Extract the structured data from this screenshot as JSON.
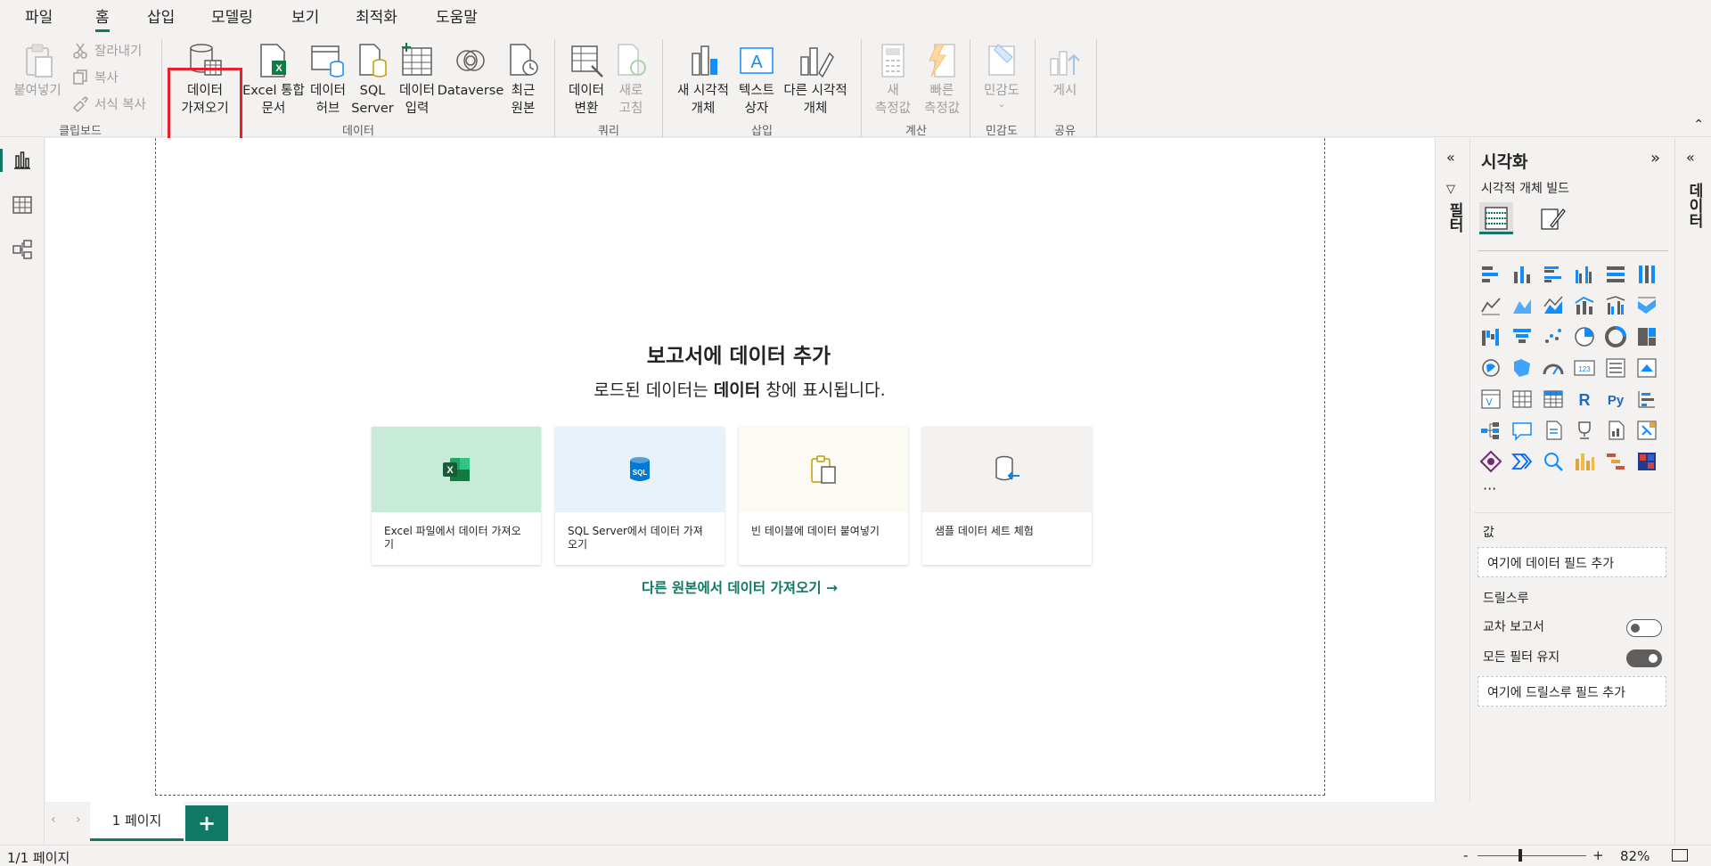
{
  "menu": {
    "items": [
      "파일",
      "홈",
      "삽입",
      "모델링",
      "보기",
      "최적화",
      "도움말"
    ],
    "active_index": 1
  },
  "ribbon": {
    "clipboard": {
      "paste": "붙여넣기",
      "cut": "잘라내기",
      "copy": "복사",
      "format_painter": "서식 복사",
      "group": "클립보드"
    },
    "data": {
      "get_data": "데이터\n가져오기",
      "excel": "Excel 통합\n문서",
      "datahub": "데이터\n허브",
      "sql": "SQL\nServer",
      "enter_data": "데이터\n입력",
      "dataverse": "Dataverse",
      "recent": "최근\n원본",
      "group": "데이터"
    },
    "query": {
      "transform": "데이터\n변환",
      "refresh": "새로\n고침",
      "group": "쿼리"
    },
    "insert": {
      "new_visual": "새 시각적\n개체",
      "textbox": "텍스트\n상자",
      "more_visuals": "다른 시각적\n개체",
      "group": "삽입"
    },
    "calc": {
      "new_measure": "새\n측정값",
      "quick_measure": "빠른\n측정값",
      "group": "계산"
    },
    "sensitivity": {
      "label": "민감도",
      "group": "민감도"
    },
    "share": {
      "publish": "게시",
      "group": "공유"
    }
  },
  "canvas": {
    "title": "보고서에 데이터 추가",
    "subtitle_pre": "로드된 데이터는 ",
    "subtitle_bold": "데이터",
    "subtitle_post": " 창에 표시됩니다.",
    "cards": [
      {
        "label": "Excel 파일에서 데이터 가져오기",
        "color": "#c7ebd8"
      },
      {
        "label": "SQL Server에서 데이터 가져오기",
        "color": "#e8f2fb"
      },
      {
        "label": "빈 테이블에 데이터 붙여넣기",
        "color": "#fbfaf3"
      },
      {
        "label": "샘플 데이터 세트 체험",
        "color": "#f3f2f1"
      }
    ],
    "other_sources": "다른 원본에서 데이터 가져오기 →"
  },
  "filters": {
    "label": "필터"
  },
  "visualizations": {
    "title": "시각화",
    "build_label": "시각적 개체 빌드",
    "more": "···",
    "values_label": "값",
    "values_placeholder": "여기에 데이터 필드 추가",
    "drillthrough_label": "드릴스루",
    "cross_report": "교차 보고서",
    "cross_report_on": false,
    "keep_filters": "모든 필터 유지",
    "keep_filters_on": true,
    "drill_placeholder": "여기에 드릴스루 필드 추가"
  },
  "data_pane": {
    "label": "데이터"
  },
  "pages": {
    "tabs": [
      "1 페이지"
    ],
    "add_label": "+"
  },
  "status": {
    "page_count": "1/1 페이지",
    "zoom_minus": "-",
    "zoom_plus": "+",
    "zoom": "82%"
  },
  "colors": {
    "accent": "#117865",
    "highlight": "#e3242b",
    "viz_blue": "#118dff"
  }
}
